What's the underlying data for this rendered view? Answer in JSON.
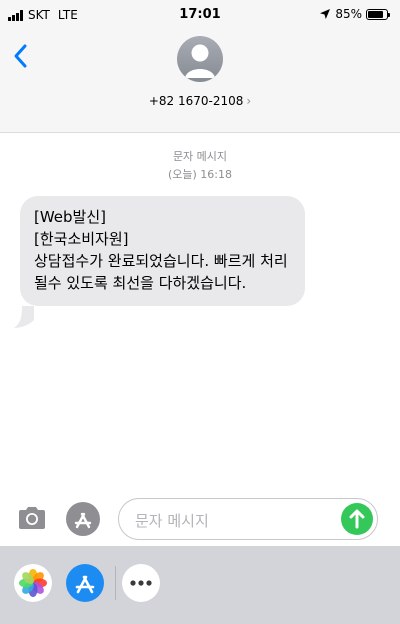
{
  "status_bar": {
    "carrier": "SKT",
    "network": "LTE",
    "time": "17:01",
    "battery": "85%",
    "battery_level": 0.85
  },
  "header": {
    "contact_number": "+82 1670-2108",
    "chevron": "›"
  },
  "conversation": {
    "label": "문자 메시지",
    "timestamp": "(오늘) 16:18",
    "messages": [
      {
        "lines": [
          "[Web발신]",
          "[한국소비자원]",
          "상담접수가 완료되었습니다. 빠르게 처리",
          "될수 있도록 최선을 다하겠습니다."
        ]
      }
    ]
  },
  "input": {
    "placeholder": "문자 메시지"
  },
  "icons": {
    "back": "chevron-left-icon",
    "avatar": "person-icon",
    "camera": "camera-icon",
    "appstore": "appstore-icon",
    "send": "arrow-up-icon",
    "photos": "photos-icon",
    "more": "ellipsis-icon",
    "location": "location-arrow-icon"
  },
  "colors": {
    "accent": "#007aff",
    "bubble": "#e9e9eb",
    "send": "#34c759",
    "drawer": "#d2d4d9"
  }
}
